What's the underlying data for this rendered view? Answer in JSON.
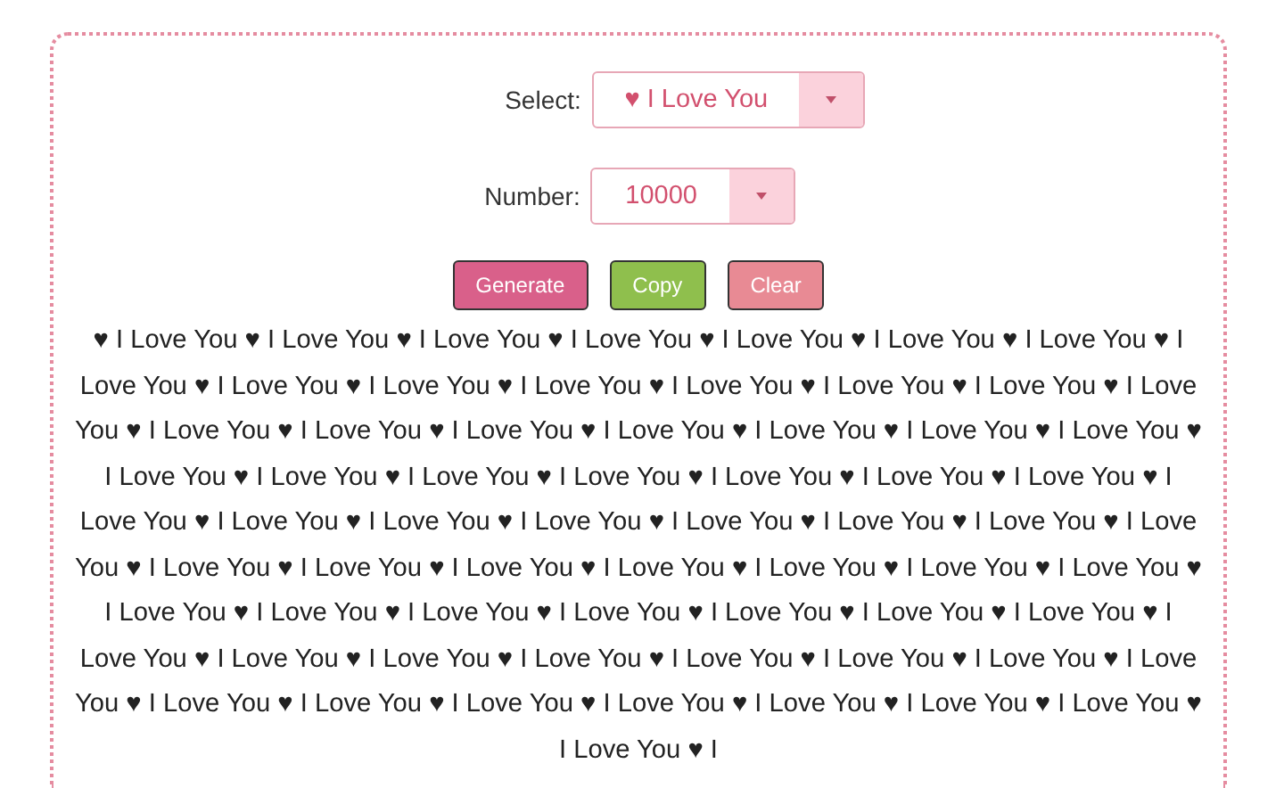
{
  "select": {
    "label": "Select:",
    "value": "♥ I Love You"
  },
  "number": {
    "label": "Number:",
    "value": "10000"
  },
  "buttons": [
    {
      "label": "Generate",
      "kind": "generate"
    },
    {
      "label": "Copy",
      "kind": "copy"
    },
    {
      "label": "Clear",
      "kind": "clear"
    }
  ],
  "output": "♥ I Love You ♥ I Love You ♥ I Love You ♥ I Love You ♥ I Love You ♥ I Love You ♥ I Love You ♥ I Love You ♥ I Love You ♥ I Love You ♥ I Love You ♥ I Love You ♥ I Love You ♥ I Love You ♥ I Love You ♥ I Love You ♥ I Love You ♥ I Love You ♥ I Love You ♥ I Love You ♥ I Love You ♥ I Love You ♥ I Love You ♥ I Love You ♥ I Love You ♥ I Love You ♥ I Love You ♥ I Love You ♥ I Love You ♥ I Love You ♥ I Love You ♥ I Love You ♥ I Love You ♥ I Love You ♥ I Love You ♥ I Love You ♥ I Love You ♥ I Love You ♥ I Love You ♥ I Love You ♥ I Love You ♥ I Love You ♥ I Love You ♥ I Love You ♥ I Love You ♥ I Love You ♥ I Love You ♥ I Love You ♥ I Love You ♥ I Love You ♥ I Love You ♥ I Love You ♥ I Love You ♥ I Love You ♥ I Love You ♥ I Love You ♥ I Love You ♥ I Love You ♥ I Love You ♥ I Love You ♥ I Love You ♥ I Love You ♥ I Love You ♥ I Love You ♥ I Love You ♥ I Love You ♥ I Love You ♥ I"
}
